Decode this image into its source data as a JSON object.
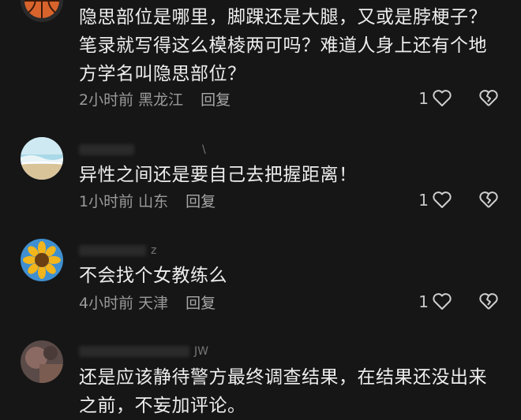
{
  "comments": [
    {
      "username_hint": "",
      "text": "隐思部位是哪里，脚踝还是大腿，又或是脖梗子？笔录就写得这么模棱两可吗？难道人身上还有个地方学名叫隐思部位？",
      "time": "2小时前",
      "location": "黑龙江",
      "reply_label": "回复",
      "likes": "1",
      "avatar": "basketball"
    },
    {
      "username_hint": "\\",
      "text": "异性之间还是要自己去把握距离！",
      "time": "1小时前",
      "location": "山东",
      "reply_label": "回复",
      "likes": "1",
      "avatar": "beach"
    },
    {
      "username_hint": "z",
      "text": "不会找个女教练么",
      "time": "4小时前",
      "location": "天津",
      "reply_label": "回复",
      "likes": "1",
      "avatar": "sunflower"
    },
    {
      "username_hint": "JW",
      "text": "还是应该静待警方最终调查结果，在结果还没出来之前，不妄加评论。",
      "time": "",
      "location": "",
      "reply_label": "",
      "likes": "",
      "avatar": "blurred-photo"
    }
  ],
  "colors": {
    "background": "#161616",
    "text": "#ededed",
    "meta": "#9a9a9a"
  },
  "icons": {
    "like": "heart-outline-icon",
    "dislike": "broken-heart-icon"
  }
}
